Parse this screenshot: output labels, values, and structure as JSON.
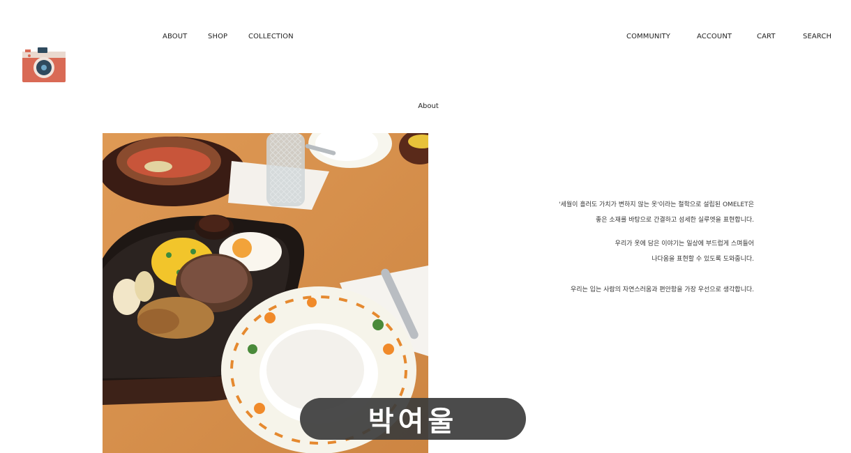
{
  "header": {
    "logo_icon": "camera-icon",
    "nav_left": [
      "ABOUT",
      "SHOP",
      "COLLECTION"
    ],
    "nav_right": [
      "COMMUNITY",
      "ACCOUNT",
      "CART",
      "SEARCH"
    ]
  },
  "main": {
    "title": "About",
    "photo_icon": "food-photo",
    "description": [
      "'세월이 흘러도 가치가 변하지 않는 옷'이라는 철학으로 설립된 OMELET은",
      "좋은 소재를 바탕으로 간결하고 섬세한 실루엣을 표현합니다.",
      "우리가 옷에 담은 이야기는 일상에 부드럽게 스며들어",
      "나다움을 표현할 수 있도록 도와줍니다.",
      "우리는 입는 사람의 자연스러움과 편안함을 가장 우선으로 생각합니다."
    ]
  },
  "overlay": {
    "name": "박여울"
  },
  "colors": {
    "logo_red": "#d96a55",
    "pill_bg": "#3c3c3c",
    "table_wood": "#d48a45"
  }
}
